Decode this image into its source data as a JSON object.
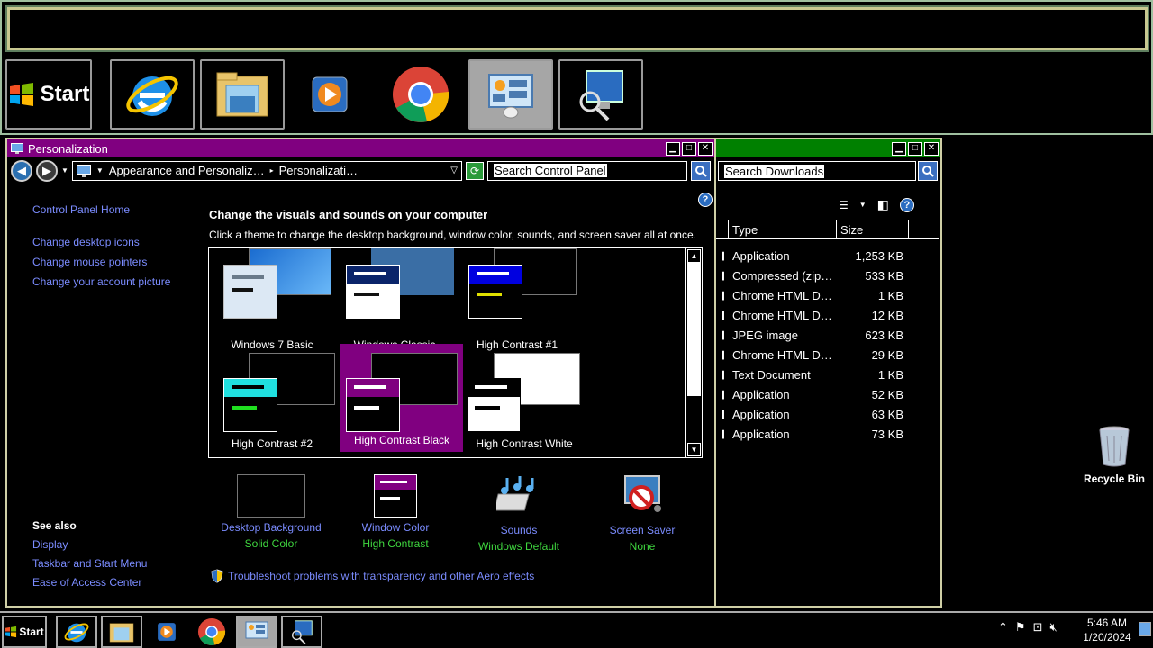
{
  "top_dock": {
    "start_label": "Start"
  },
  "personalization_window": {
    "title": "Personalization",
    "breadcrumb_1": "Appearance and Personaliz…",
    "breadcrumb_2": "Personalizati…",
    "search_placeholder": "Search Control Panel",
    "sidebar": {
      "home": "Control Panel Home",
      "links": [
        "Change desktop icons",
        "Change mouse pointers",
        "Change your account picture"
      ],
      "see_also_heading": "See also",
      "see_also": [
        "Display",
        "Taskbar and Start Menu",
        "Ease of Access Center"
      ]
    },
    "heading": "Change the visuals and sounds on your computer",
    "subheading": "Click a theme to change the desktop background, window color, sounds, and screen saver all at once.",
    "themes": [
      {
        "name": "Windows 7 Basic"
      },
      {
        "name": "Windows Classic"
      },
      {
        "name": "High Contrast #1"
      },
      {
        "name": "High Contrast #2"
      },
      {
        "name": "High Contrast Black"
      },
      {
        "name": "High Contrast White"
      }
    ],
    "selected_theme": "High Contrast Black",
    "settings": [
      {
        "label": "Desktop Background",
        "value": "Solid Color"
      },
      {
        "label": "Window Color",
        "value": "High Contrast"
      },
      {
        "label": "Sounds",
        "value": "Windows Default"
      },
      {
        "label": "Screen Saver",
        "value": "None"
      }
    ],
    "troubleshoot": "Troubleshoot problems with transparency and other Aero effects"
  },
  "downloads_window": {
    "search_placeholder": "Search Downloads",
    "columns": [
      "Type",
      "Size"
    ],
    "rows": [
      {
        "type": "Application",
        "size": "1,253 KB"
      },
      {
        "type": "Compressed (zip…",
        "size": "533 KB"
      },
      {
        "type": "Chrome HTML D…",
        "size": "1 KB"
      },
      {
        "type": "Chrome HTML D…",
        "size": "12 KB"
      },
      {
        "type": "JPEG image",
        "size": "623 KB"
      },
      {
        "type": "Chrome HTML D…",
        "size": "29 KB"
      },
      {
        "type": "Text Document",
        "size": "1 KB"
      },
      {
        "type": "Application",
        "size": "52 KB"
      },
      {
        "type": "Application",
        "size": "63 KB"
      },
      {
        "type": "Application",
        "size": "73 KB"
      }
    ]
  },
  "desktop": {
    "recycle_bin": "Recycle Bin"
  },
  "taskbar": {
    "start_label": "Start",
    "time": "5:46 AM",
    "date": "1/20/2024"
  },
  "colors": {
    "selection_purple": "#800080",
    "side_title_green": "#008000",
    "link_blue": "#7b8cff",
    "value_green": "#3fd63f"
  }
}
